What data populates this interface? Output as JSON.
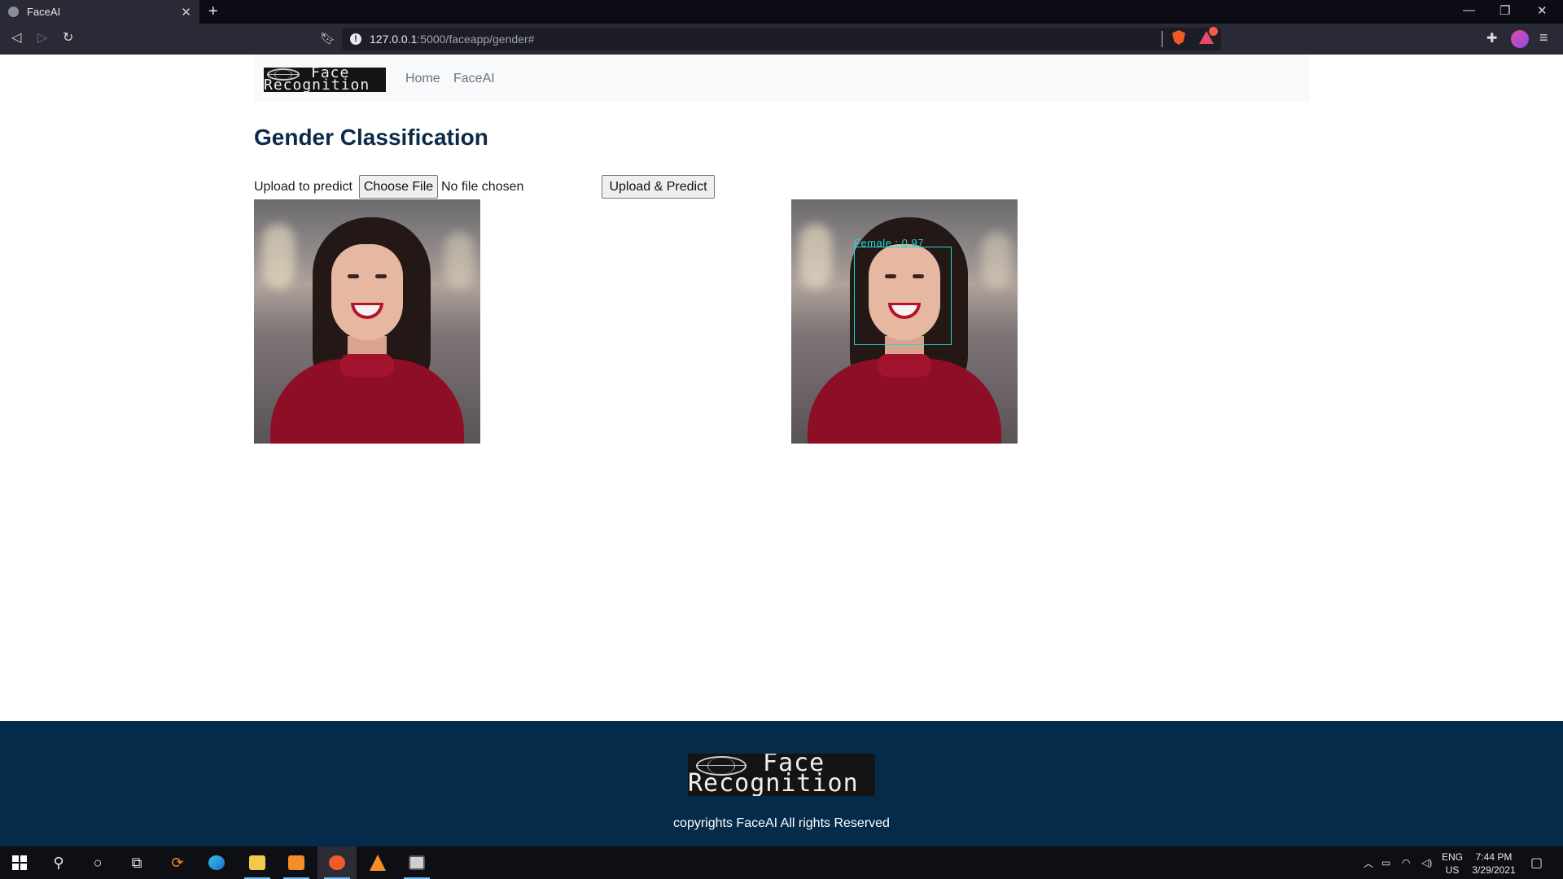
{
  "browser": {
    "tab_title": "FaceAI",
    "new_tab": "+",
    "url_host": "127.0.0.1",
    "url_rest": ":5000/faceapp/gender#"
  },
  "site": {
    "logo_line1": "Face",
    "logo_line2": "Recognition",
    "nav_links": [
      "Home",
      "FaceAI"
    ]
  },
  "main": {
    "heading": "Gender Classification",
    "upload_label": "Upload to predict",
    "choose_file_label": "Choose File",
    "no_file_text": "No file chosen",
    "predict_button_label": "Upload & Predict",
    "prediction_label": "Female : 0.97"
  },
  "footer": {
    "logo_line1": "Face",
    "logo_line2": "Recognition",
    "copyright": "copyrights FaceAI All rights Reserved"
  },
  "taskbar": {
    "lang_line1": "ENG",
    "lang_line2": "US",
    "time": "7:44 PM",
    "date": "3/29/2021"
  },
  "colors": {
    "heading": "#0b2b4a",
    "footer_bg": "#052b4a",
    "bbox": "#21d6d6"
  }
}
